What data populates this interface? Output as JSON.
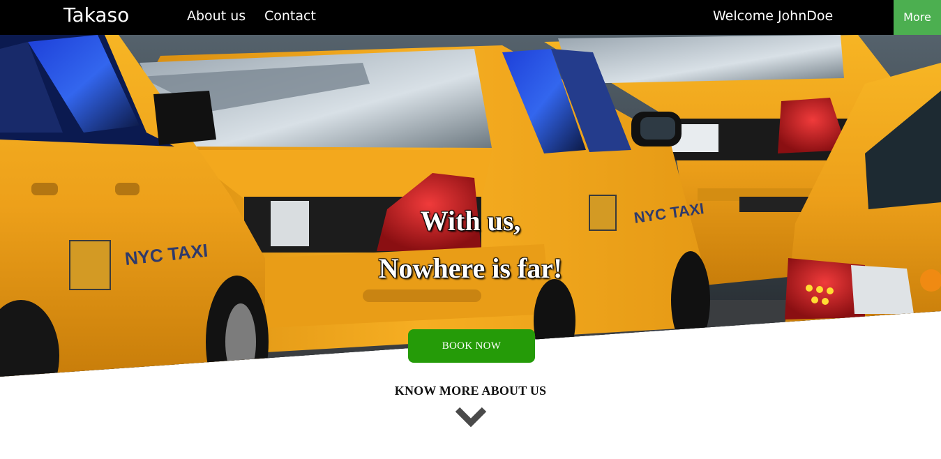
{
  "navbar": {
    "brand": "Takaso",
    "links": [
      {
        "label": "About us"
      },
      {
        "label": "Contact"
      }
    ],
    "welcome": "Welcome JohnDoe",
    "more_label": "More"
  },
  "hero": {
    "headline_line1": "With us,",
    "headline_line2": "Nowhere is far!",
    "cta_label": "BOOK NOW"
  },
  "know_more": {
    "label": "KNOW MORE ABOUT US",
    "icon": "chevron-down-icon"
  },
  "colors": {
    "navbar_bg": "#000000",
    "more_button": "#4caf50",
    "book_button": "#259b08",
    "taxi_yellow": "#f0a416"
  }
}
